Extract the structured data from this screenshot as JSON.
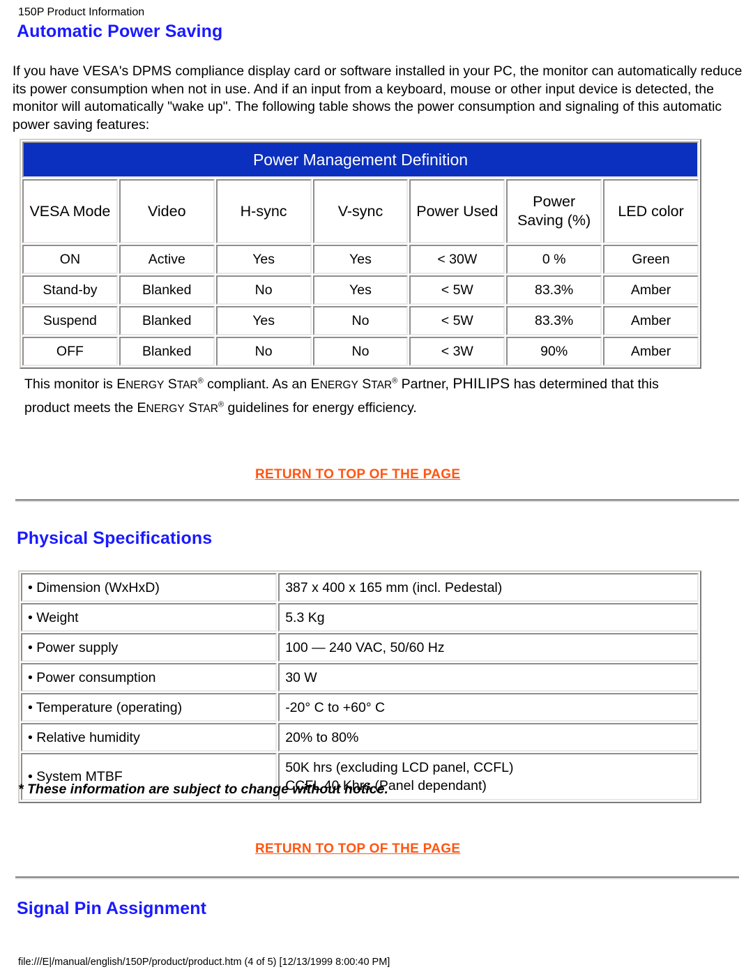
{
  "document": {
    "header_label": "150P Product Information",
    "footer_path": "file:///E|/manual/english/150P/product/product.htm (4 of 5) [12/13/1999 8:00:40 PM]",
    "link_color": "#ff5511",
    "heading_color": "#1a1aff",
    "table_banner_color": "#0b2fbe"
  },
  "sections": {
    "automatic_power_saving": {
      "title": "Automatic Power Saving",
      "intro": "If you have VESA's DPMS compliance display card or software installed in your PC, the monitor can automatically reduce its power consumption when not in use. And if an input from a keyboard, mouse or other input device is detected, the monitor will automatically \"wake up\". The following table shows the power consumption and signaling of this automatic power saving features:",
      "energy_star_note": {
        "part1": "This monitor is ",
        "brand1": "ENERGY STAR",
        "part2": " compliant. As an ",
        "brand2": "ENERGY STAR",
        "part3": " Partner, ",
        "company": "PHILIPS",
        "part4": " has determined that this product meets the ",
        "brand3": "ENERGY STAR",
        "part5": " guidelines for energy efficiency."
      }
    },
    "physical_specifications": {
      "title": "Physical Specifications",
      "footnote": "* These information are subject to change without notice."
    },
    "signal_pin_assignment": {
      "title": "Signal Pin Assignment"
    }
  },
  "links": {
    "return_to_top": "RETURN TO TOP OF THE PAGE"
  },
  "chart_data": {
    "type": "table",
    "title": "Power Management Definition",
    "columns": [
      "VESA Mode",
      "Video",
      "H-sync",
      "V-sync",
      "Power Used",
      "Power Saving (%)",
      "LED color"
    ],
    "column_header_lines": [
      [
        "VESA Mode"
      ],
      [
        "Video"
      ],
      [
        "H-sync"
      ],
      [
        "V-sync"
      ],
      [
        "Power Used"
      ],
      [
        "Power",
        "Saving (%)"
      ],
      [
        "LED color"
      ]
    ],
    "rows": [
      [
        "ON",
        "Active",
        "Yes",
        "Yes",
        "< 30W",
        "0 %",
        "Green"
      ],
      [
        "Stand-by",
        "Blanked",
        "No",
        "Yes",
        "< 5W",
        "83.3%",
        "Amber"
      ],
      [
        "Suspend",
        "Blanked",
        "Yes",
        "No",
        "< 5W",
        "83.3%",
        "Amber"
      ],
      [
        "OFF",
        "Blanked",
        "No",
        "No",
        "< 3W",
        "90%",
        "Amber"
      ]
    ]
  },
  "physical_specs_table": {
    "type": "table",
    "rows": [
      {
        "label": "• Dimension (WxHxD)",
        "value": "387 x 400 x 165 mm (incl. Pedestal)"
      },
      {
        "label": "• Weight",
        "value": "5.3 Kg"
      },
      {
        "label": "• Power supply",
        "value": "100 — 240 VAC, 50/60 Hz"
      },
      {
        "label": "• Power consumption",
        "value": "30 W"
      },
      {
        "label": "• Temperature (operating)",
        "value": "-20° C to +60° C"
      },
      {
        "label": "• Relative humidity",
        "value": "20% to 80%"
      },
      {
        "label": "• System MTBF",
        "value": "50K hrs (excluding LCD panel, CCFL)\nCCFL 40 Khrs (Panel dependant)"
      }
    ]
  }
}
